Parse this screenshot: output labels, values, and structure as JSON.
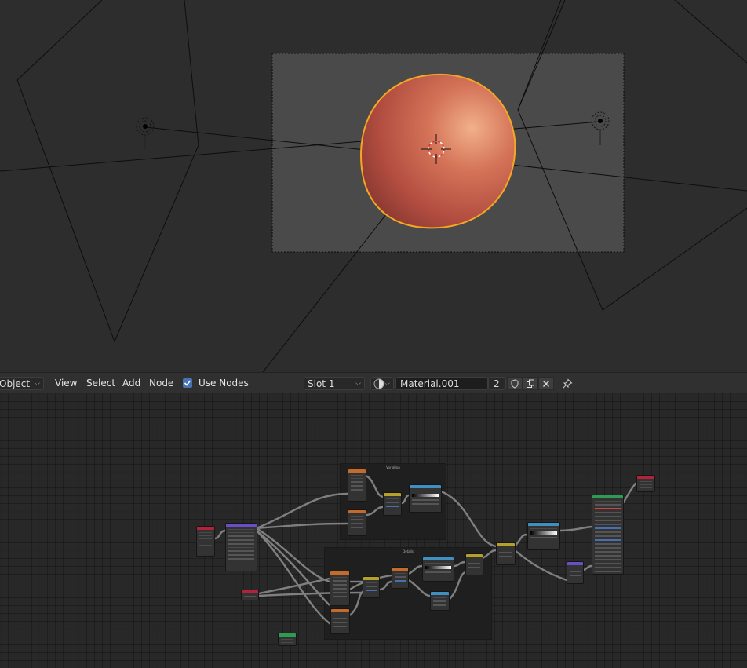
{
  "viewport": {
    "selection_color": "#f5a623",
    "object_color": "#c8604a"
  },
  "header": {
    "mode": "Object",
    "menu": {
      "view": "View",
      "select": "Select",
      "add": "Add",
      "node": "Node"
    },
    "use_nodes_label": "Use Nodes",
    "use_nodes_checked": true,
    "slot": "Slot 1",
    "material_name": "Material.001",
    "users": "2",
    "icons": [
      "sphere-preview-icon",
      "fake-user-shield-icon",
      "duplicate-icon",
      "close-icon",
      "pin-icon"
    ]
  },
  "node_editor": {
    "frames": [
      "Variation",
      "Details"
    ]
  }
}
